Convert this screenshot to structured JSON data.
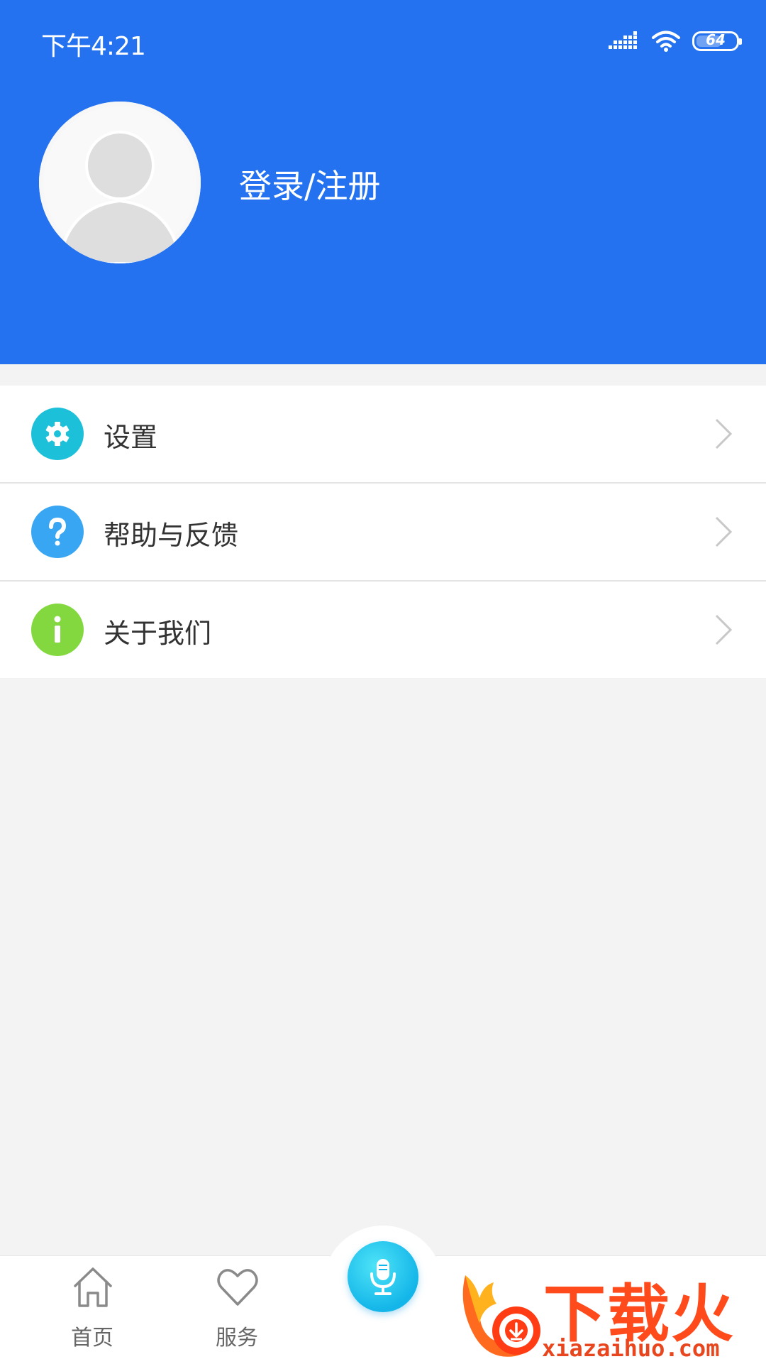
{
  "status_bar": {
    "time": "下午4:21",
    "battery": "64",
    "battery_level_fraction": 0.64,
    "icons": [
      "signal-icon",
      "wifi-icon",
      "battery-icon"
    ]
  },
  "header": {
    "login_label": "登录/注册",
    "background_color": "#2472ef"
  },
  "menu": [
    {
      "label": "设置",
      "icon": "gear-icon",
      "color": "#1cc0d8"
    },
    {
      "label": "帮助与反馈",
      "icon": "question-icon",
      "color": "#38a6f2"
    },
    {
      "label": "关于我们",
      "icon": "info-icon",
      "color": "#84d83f"
    }
  ],
  "tabbar": {
    "tabs": [
      {
        "label": "首页",
        "icon": "home-icon"
      },
      {
        "label": "服务",
        "icon": "heart-icon"
      }
    ],
    "center_button": {
      "icon": "microphone-icon",
      "color": "#1ab8ea"
    }
  },
  "watermark": {
    "title": "下载火",
    "url": "xiazaihuo.com"
  }
}
